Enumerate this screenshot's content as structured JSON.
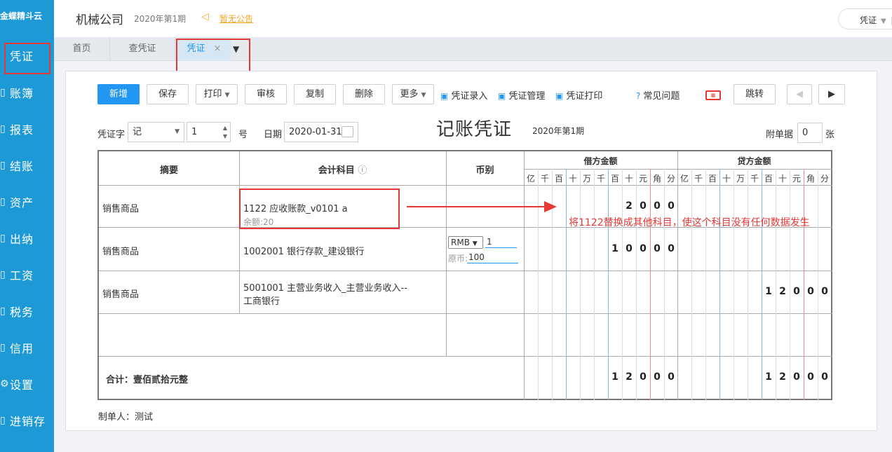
{
  "app": {
    "logo": "金蝶精斗云"
  },
  "sidebar": {
    "items": [
      {
        "icon": "",
        "label": "凭证"
      },
      {
        "icon": "",
        "label": "账簿"
      },
      {
        "icon": "",
        "label": "报表"
      },
      {
        "icon": "",
        "label": "结账"
      },
      {
        "icon": "",
        "label": "资产"
      },
      {
        "icon": "",
        "label": "出纳"
      },
      {
        "icon": "",
        "label": "工资"
      },
      {
        "icon": "",
        "label": "税务"
      },
      {
        "icon": "",
        "label": "信用"
      },
      {
        "icon": "",
        "label": "设置"
      },
      {
        "icon": "",
        "label": "进销存"
      }
    ]
  },
  "header": {
    "company": "机械公司",
    "period": "2020年第1期",
    "notice": "暂无公告",
    "select_value": "凭证"
  },
  "tabs": [
    {
      "label": "首页"
    },
    {
      "label": "查凭证"
    },
    {
      "label": "凭证",
      "close": "×"
    }
  ],
  "toolbar": {
    "new": "新增",
    "save": "保存",
    "print": "打印",
    "audit": "审核",
    "copy": "复制",
    "delete": "删除",
    "more": "更多",
    "entry": "凭证录入",
    "manage": "凭证管理",
    "print_voucher": "凭证打印",
    "faq": "常见问题",
    "jump": "跳转"
  },
  "voucher": {
    "word_label": "凭证字",
    "word_value": "记",
    "number_value": "1",
    "number_suffix": "号",
    "date_label": "日期",
    "date_value": "2020-01-31",
    "title": "记账凭证",
    "period": "2020年第1期",
    "attach_label": "附单据",
    "attach_value": "0",
    "attach_unit": "张"
  },
  "table": {
    "headers": {
      "summary": "摘要",
      "account": "会计科目",
      "currency": "币别",
      "debit": "借方金额",
      "credit": "贷方金额"
    },
    "units": [
      "亿",
      "千",
      "百",
      "十",
      "万",
      "千",
      "百",
      "十",
      "元",
      "角",
      "分"
    ],
    "rows": [
      {
        "summary": "销售商品",
        "account": "1122 应收账款_v0101 a",
        "balance": "余额:20",
        "debit": [
          "2",
          "0",
          "0",
          "0"
        ],
        "credit": []
      },
      {
        "summary": "销售商品",
        "account": "1002001 银行存款_建设银行",
        "currency": "RMB",
        "rate": "1",
        "orig_label": "原币:",
        "orig_value": "100",
        "debit": [
          "1",
          "0",
          "0",
          "0",
          "0"
        ],
        "credit": []
      },
      {
        "summary": "销售商品",
        "account_line1": "5001001 主营业务收入_主营业务收入--",
        "account_line2": "工商银行",
        "debit": [],
        "credit": [
          "1",
          "2",
          "0",
          "0",
          "0"
        ]
      }
    ],
    "total_label": "合计：壹佰贰拾元整",
    "total_debit": [
      "1",
      "2",
      "0",
      "0",
      "0"
    ],
    "total_credit": [
      "1",
      "2",
      "0",
      "0",
      "0"
    ]
  },
  "annotation": "将1122替换成其他科目，使这个科目没有任何数据发生",
  "maker": "制单人：测试",
  "colors": {
    "sidebar": "#1d9ad6",
    "primary": "#2196f3",
    "annotation": "#e53935"
  }
}
